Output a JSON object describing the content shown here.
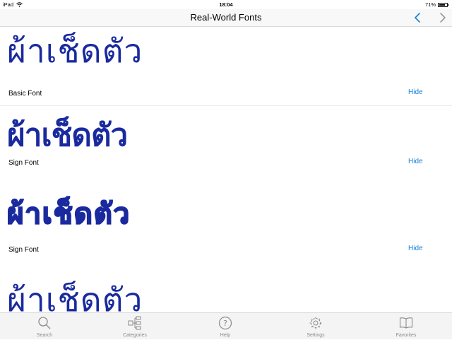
{
  "status_bar": {
    "device": "iPad",
    "time": "18:04",
    "battery": "71%"
  },
  "navbar": {
    "title": "Real-World Fonts",
    "back_icon": "chevron-left-icon",
    "forward_icon": "chevron-right-icon",
    "accent_color": "#1a80d6"
  },
  "samples": {
    "sample_text": "ผ้าเช็ดตัว",
    "text_color": "#1a2a9e",
    "rows": [
      {
        "label": "Basic Font",
        "action": "Hide"
      },
      {
        "label": "Sign Font",
        "action": "Hide"
      },
      {
        "label": "Sign Font",
        "action": "Hide"
      }
    ]
  },
  "tabbar": {
    "tabs": [
      {
        "label": "Search",
        "icon": "search-icon"
      },
      {
        "label": "Categories",
        "icon": "categories-icon"
      },
      {
        "label": "Help",
        "icon": "help-icon"
      },
      {
        "label": "Settings",
        "icon": "gear-icon"
      },
      {
        "label": "Favorites",
        "icon": "book-icon"
      }
    ]
  }
}
